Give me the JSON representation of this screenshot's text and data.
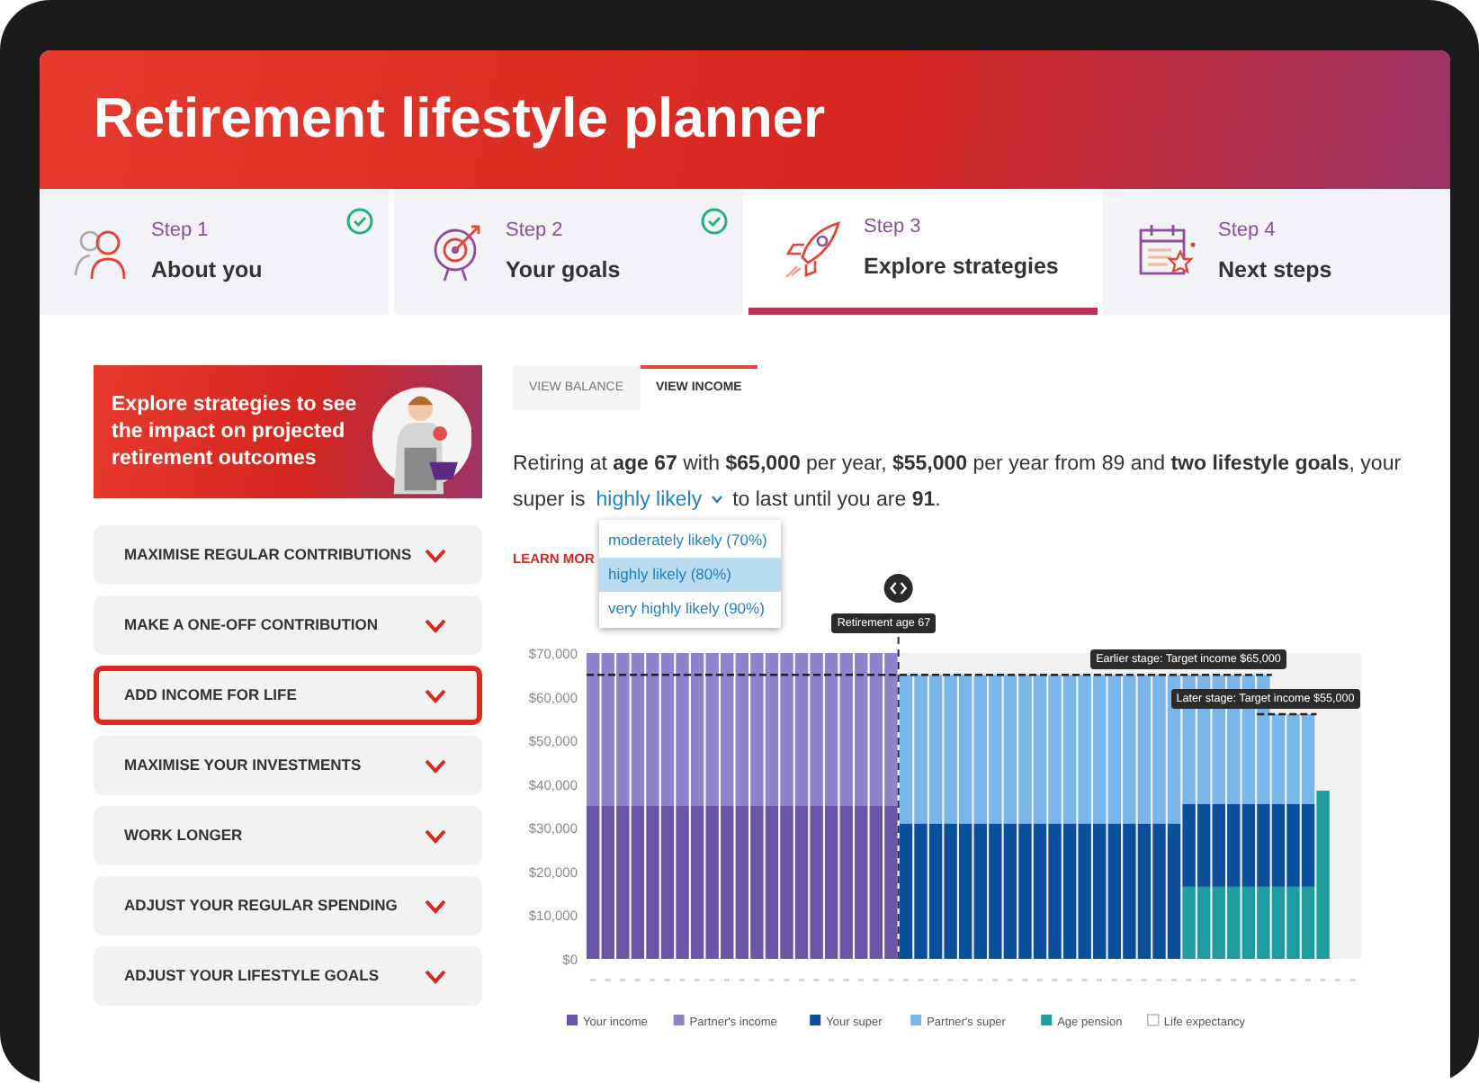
{
  "header": {
    "title": "Retirement lifestyle planner"
  },
  "steps": [
    {
      "label": "Step 1",
      "title": "About you",
      "completed": true,
      "selected": false,
      "kind": "people"
    },
    {
      "label": "Step 2",
      "title": "Your goals",
      "completed": true,
      "selected": false,
      "kind": "target"
    },
    {
      "label": "Step 3",
      "title": "Explore strategies",
      "completed": false,
      "selected": true,
      "kind": "rocket"
    },
    {
      "label": "Step 4",
      "title": "Next steps",
      "completed": false,
      "selected": false,
      "kind": "calendar"
    }
  ],
  "promo": {
    "text": "Explore strategies to see the impact on projected retirement outcomes"
  },
  "strategies": [
    {
      "label": "MAXIMISE REGULAR CONTRIBUTIONS",
      "highlighted": false
    },
    {
      "label": "MAKE A ONE-OFF CONTRIBUTION",
      "highlighted": false
    },
    {
      "label": "ADD INCOME FOR LIFE",
      "highlighted": true
    },
    {
      "label": "MAXIMISE YOUR INVESTMENTS",
      "highlighted": false
    },
    {
      "label": "WORK LONGER",
      "highlighted": false
    },
    {
      "label": "ADJUST YOUR REGULAR SPENDING",
      "highlighted": false
    },
    {
      "label": "ADJUST YOUR LIFESTYLE GOALS",
      "highlighted": false
    }
  ],
  "view_tabs": [
    {
      "label": "VIEW BALANCE",
      "selected": false
    },
    {
      "label": "VIEW INCOME",
      "selected": true
    }
  ],
  "summary": {
    "before": "Retiring at **age 67** with **$65,000** per year, **$55,000** per year from 89 and **two lifestyle goals**, your",
    "before_dropdown": "super is",
    "likelihood": "highly likely",
    "after": "to last until you are **91**."
  },
  "learn_more": "LEARN MOR",
  "likelihood_options": [
    {
      "label": "moderately likely (70%)",
      "selected": false
    },
    {
      "label": "highly likely (80%)",
      "selected": true
    },
    {
      "label": "very highly likely (90%)",
      "selected": false
    }
  ],
  "chart": {
    "chart_data": {
      "type": "bar",
      "stacked": true,
      "legend": "bottom",
      "ylim": [
        0,
        70000
      ],
      "yticks": [
        {
          "value": 0,
          "label": "$0"
        },
        {
          "value": 10000,
          "label": "$10,000"
        },
        {
          "value": 20000,
          "label": "$20,000"
        },
        {
          "value": 30000,
          "label": "$30,000"
        },
        {
          "value": 40000,
          "label": "$40,000"
        },
        {
          "value": 50000,
          "label": "$50,000"
        },
        {
          "value": 60000,
          "label": "$60,000"
        },
        {
          "value": 70000,
          "label": "$70,000"
        }
      ],
      "series": [
        {
          "name": "Your income",
          "color": "#6a55a8",
          "values": [
            35000,
            35000,
            35000,
            35000,
            35000,
            35000,
            35000,
            35000,
            35000,
            35000,
            35000,
            35000,
            35000,
            35000,
            35000,
            35000,
            35000,
            35000,
            35000,
            35000,
            35000,
            0,
            0,
            0,
            0,
            0,
            0,
            0,
            0,
            0,
            0,
            0,
            0,
            0,
            0,
            0,
            0,
            0,
            0,
            0,
            0,
            0,
            0,
            0,
            0,
            0,
            0,
            0,
            0,
            0
          ]
        },
        {
          "name": "Partner's income",
          "color": "#8f84cc",
          "values": [
            35000,
            35000,
            35000,
            35000,
            35000,
            35000,
            35000,
            35000,
            35000,
            35000,
            35000,
            35000,
            35000,
            35000,
            35000,
            35000,
            35000,
            35000,
            35000,
            35000,
            35000,
            0,
            0,
            0,
            0,
            0,
            0,
            0,
            0,
            0,
            0,
            0,
            0,
            0,
            0,
            0,
            0,
            0,
            0,
            0,
            0,
            0,
            0,
            0,
            0,
            0,
            0,
            0,
            0,
            0
          ]
        },
        {
          "name": "Your super",
          "color": "#0a4f9c",
          "values": [
            0,
            0,
            0,
            0,
            0,
            0,
            0,
            0,
            0,
            0,
            0,
            0,
            0,
            0,
            0,
            0,
            0,
            0,
            0,
            0,
            0,
            31000,
            31000,
            31000,
            31000,
            31000,
            31000,
            31000,
            31000,
            31000,
            31000,
            31000,
            31000,
            31000,
            31000,
            31000,
            31000,
            31000,
            31000,
            31000,
            19000,
            19000,
            19000,
            19000,
            19000,
            19000,
            19000,
            19000,
            19000,
            0
          ]
        },
        {
          "name": "Partner's super",
          "color": "#7ab6ea",
          "values": [
            0,
            0,
            0,
            0,
            0,
            0,
            0,
            0,
            0,
            0,
            0,
            0,
            0,
            0,
            0,
            0,
            0,
            0,
            0,
            0,
            0,
            34000,
            34000,
            34000,
            34000,
            34000,
            34000,
            34000,
            34000,
            34000,
            34000,
            34000,
            34000,
            34000,
            34000,
            34000,
            34000,
            34000,
            34000,
            34000,
            29500,
            29500,
            29500,
            29500,
            29500,
            29500,
            20500,
            20500,
            20500,
            0
          ]
        },
        {
          "name": "Age pension",
          "color": "#1e9e9e",
          "values": [
            0,
            0,
            0,
            0,
            0,
            0,
            0,
            0,
            0,
            0,
            0,
            0,
            0,
            0,
            0,
            0,
            0,
            0,
            0,
            0,
            0,
            0,
            0,
            0,
            0,
            0,
            0,
            0,
            0,
            0,
            0,
            0,
            0,
            0,
            0,
            0,
            0,
            0,
            0,
            0,
            16500,
            16500,
            16500,
            16500,
            16500,
            16500,
            16500,
            16500,
            16500,
            38500
          ]
        }
      ],
      "ref_lines": [
        {
          "axis": "y",
          "value": 65000,
          "label": "Earlier stage: Target income $65,000"
        },
        {
          "axis": "y",
          "value": 56000,
          "label": "Later stage: Target income $55,000"
        }
      ],
      "annotations": [
        "Retirement age 67"
      ]
    },
    "life_expectancy_legend": "Life expectancy"
  }
}
